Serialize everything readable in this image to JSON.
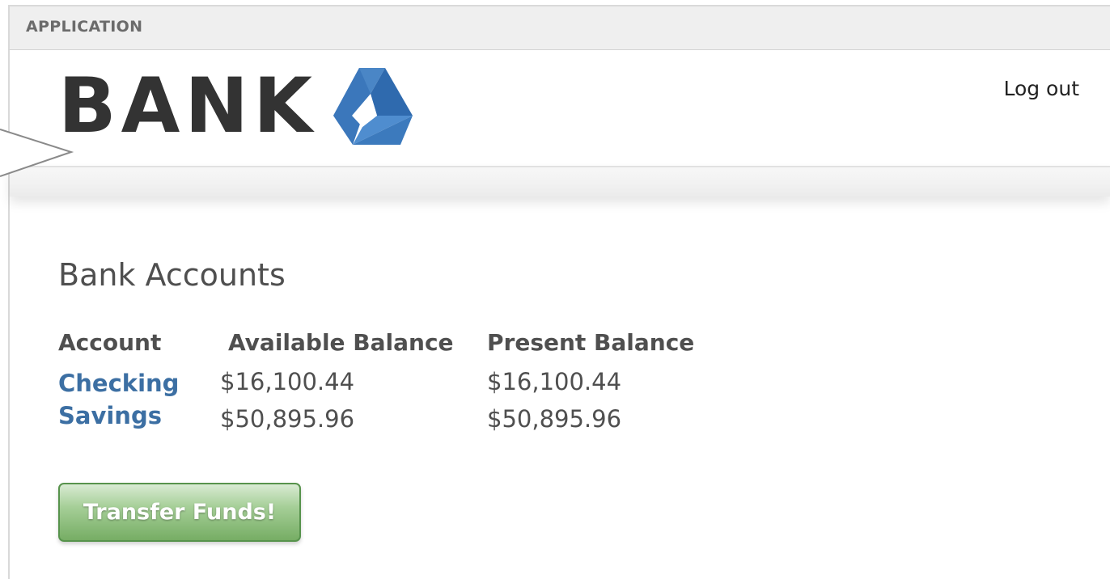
{
  "app_bar": {
    "label": "APPLICATION"
  },
  "header": {
    "logo_text": "BANK",
    "logout_label": "Log out"
  },
  "main": {
    "title": "Bank Accounts",
    "columns": [
      "Account",
      "Available Balance",
      "Present Balance"
    ],
    "accounts": [
      {
        "name": "Checking",
        "available": "$16,100.44",
        "present": "$16,100.44"
      },
      {
        "name": "Savings",
        "available": "$50,895.96",
        "present": "$50,895.96"
      }
    ],
    "transfer_label": "Transfer Funds!"
  },
  "colors": {
    "brand_blue": "#3b7bbf",
    "link": "#3c6fa3",
    "button_green": "#76ad64"
  }
}
